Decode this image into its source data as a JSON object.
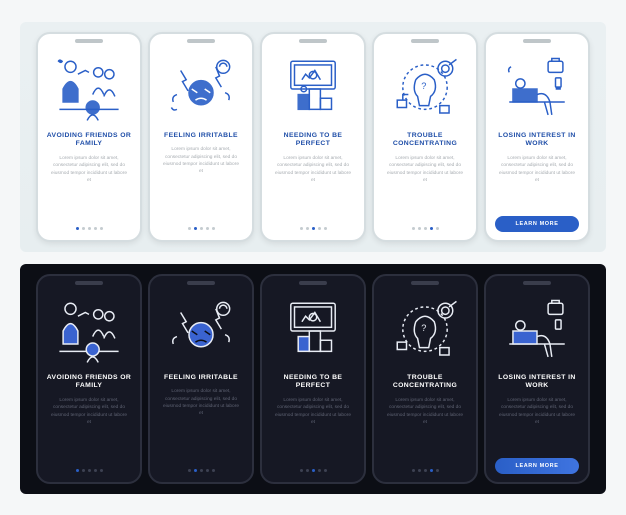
{
  "cta_label": "LEARN MORE",
  "body_placeholder": "Lorem ipsum dolor sit amet, consectetur adipiscing elit, sed do eiusmod tempor incididunt ut labore et",
  "colors": {
    "accent": "#2a5fc7",
    "light_bg": "#ffffff",
    "dark_bg": "#161824"
  },
  "screens": [
    {
      "id": "avoiding",
      "title": "AVOIDING FRIENDS OR FAMILY",
      "icon": "avoiding-icon"
    },
    {
      "id": "irritable",
      "title": "FEELING IRRITABLE",
      "icon": "irritable-icon"
    },
    {
      "id": "perfect",
      "title": "NEEDING TO BE PERFECT",
      "icon": "perfect-icon"
    },
    {
      "id": "trouble",
      "title": "TROUBLE CONCENTRATING",
      "icon": "concentrating-icon"
    },
    {
      "id": "losing",
      "title": "LOSING INTEREST IN WORK",
      "icon": "losing-interest-icon"
    }
  ]
}
